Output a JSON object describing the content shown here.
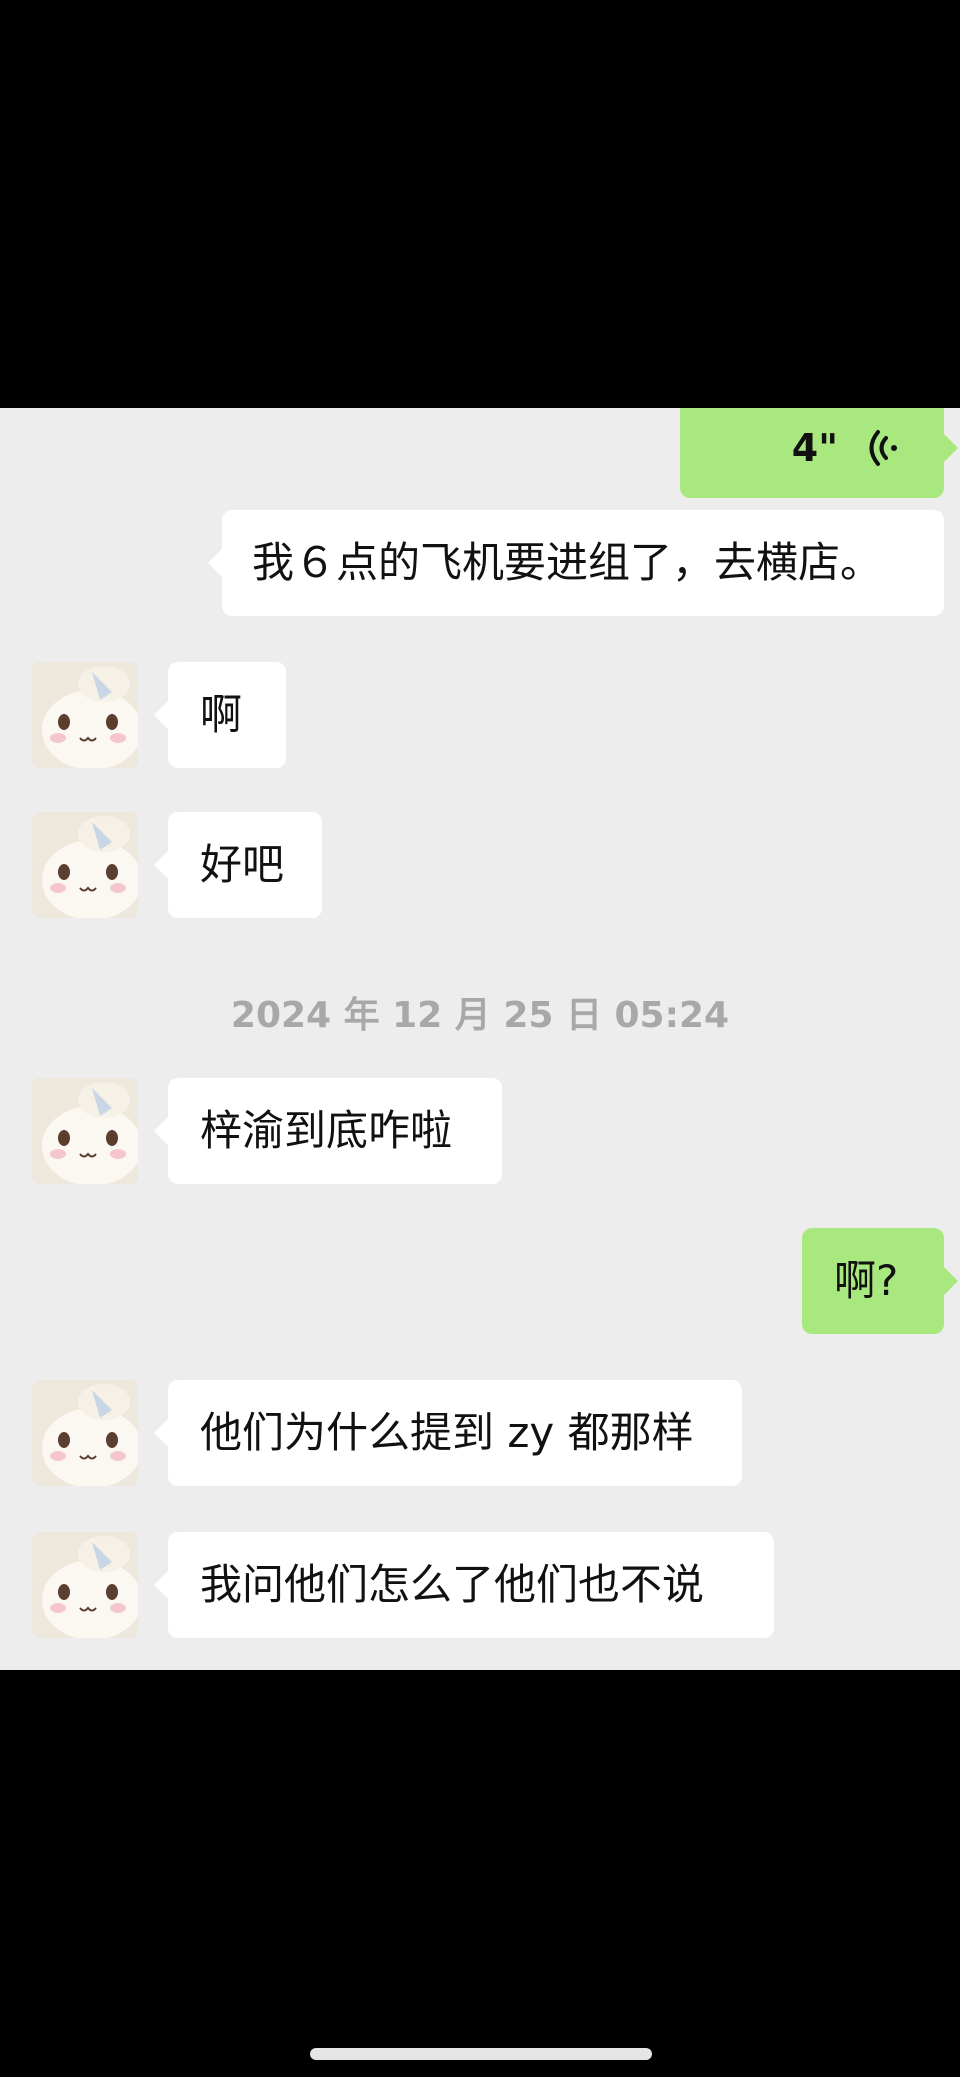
{
  "chat": {
    "voice_message": {
      "duration": "4\"",
      "icon": "voice-wave-icon"
    },
    "messages": [
      {
        "side": "right",
        "text": "我６点的飞机要进组了，去横店。"
      },
      {
        "side": "left",
        "text": "啊"
      },
      {
        "side": "left",
        "text": "好吧"
      },
      {
        "side": "left",
        "text": "梓渝到底咋啦"
      },
      {
        "side": "right",
        "text": "啊?"
      },
      {
        "side": "left",
        "text": "他们为什么提到 zy 都那样"
      },
      {
        "side": "left",
        "text": "我问他们怎么了他们也不说"
      }
    ],
    "timestamp": "2024 年 12 月 25 日 05:24"
  },
  "colors": {
    "chat_background": "#ededed",
    "outgoing_bubble": "#a9e87f",
    "incoming_bubble": "#ffffff",
    "timestamp_text": "#a8a8a8"
  }
}
